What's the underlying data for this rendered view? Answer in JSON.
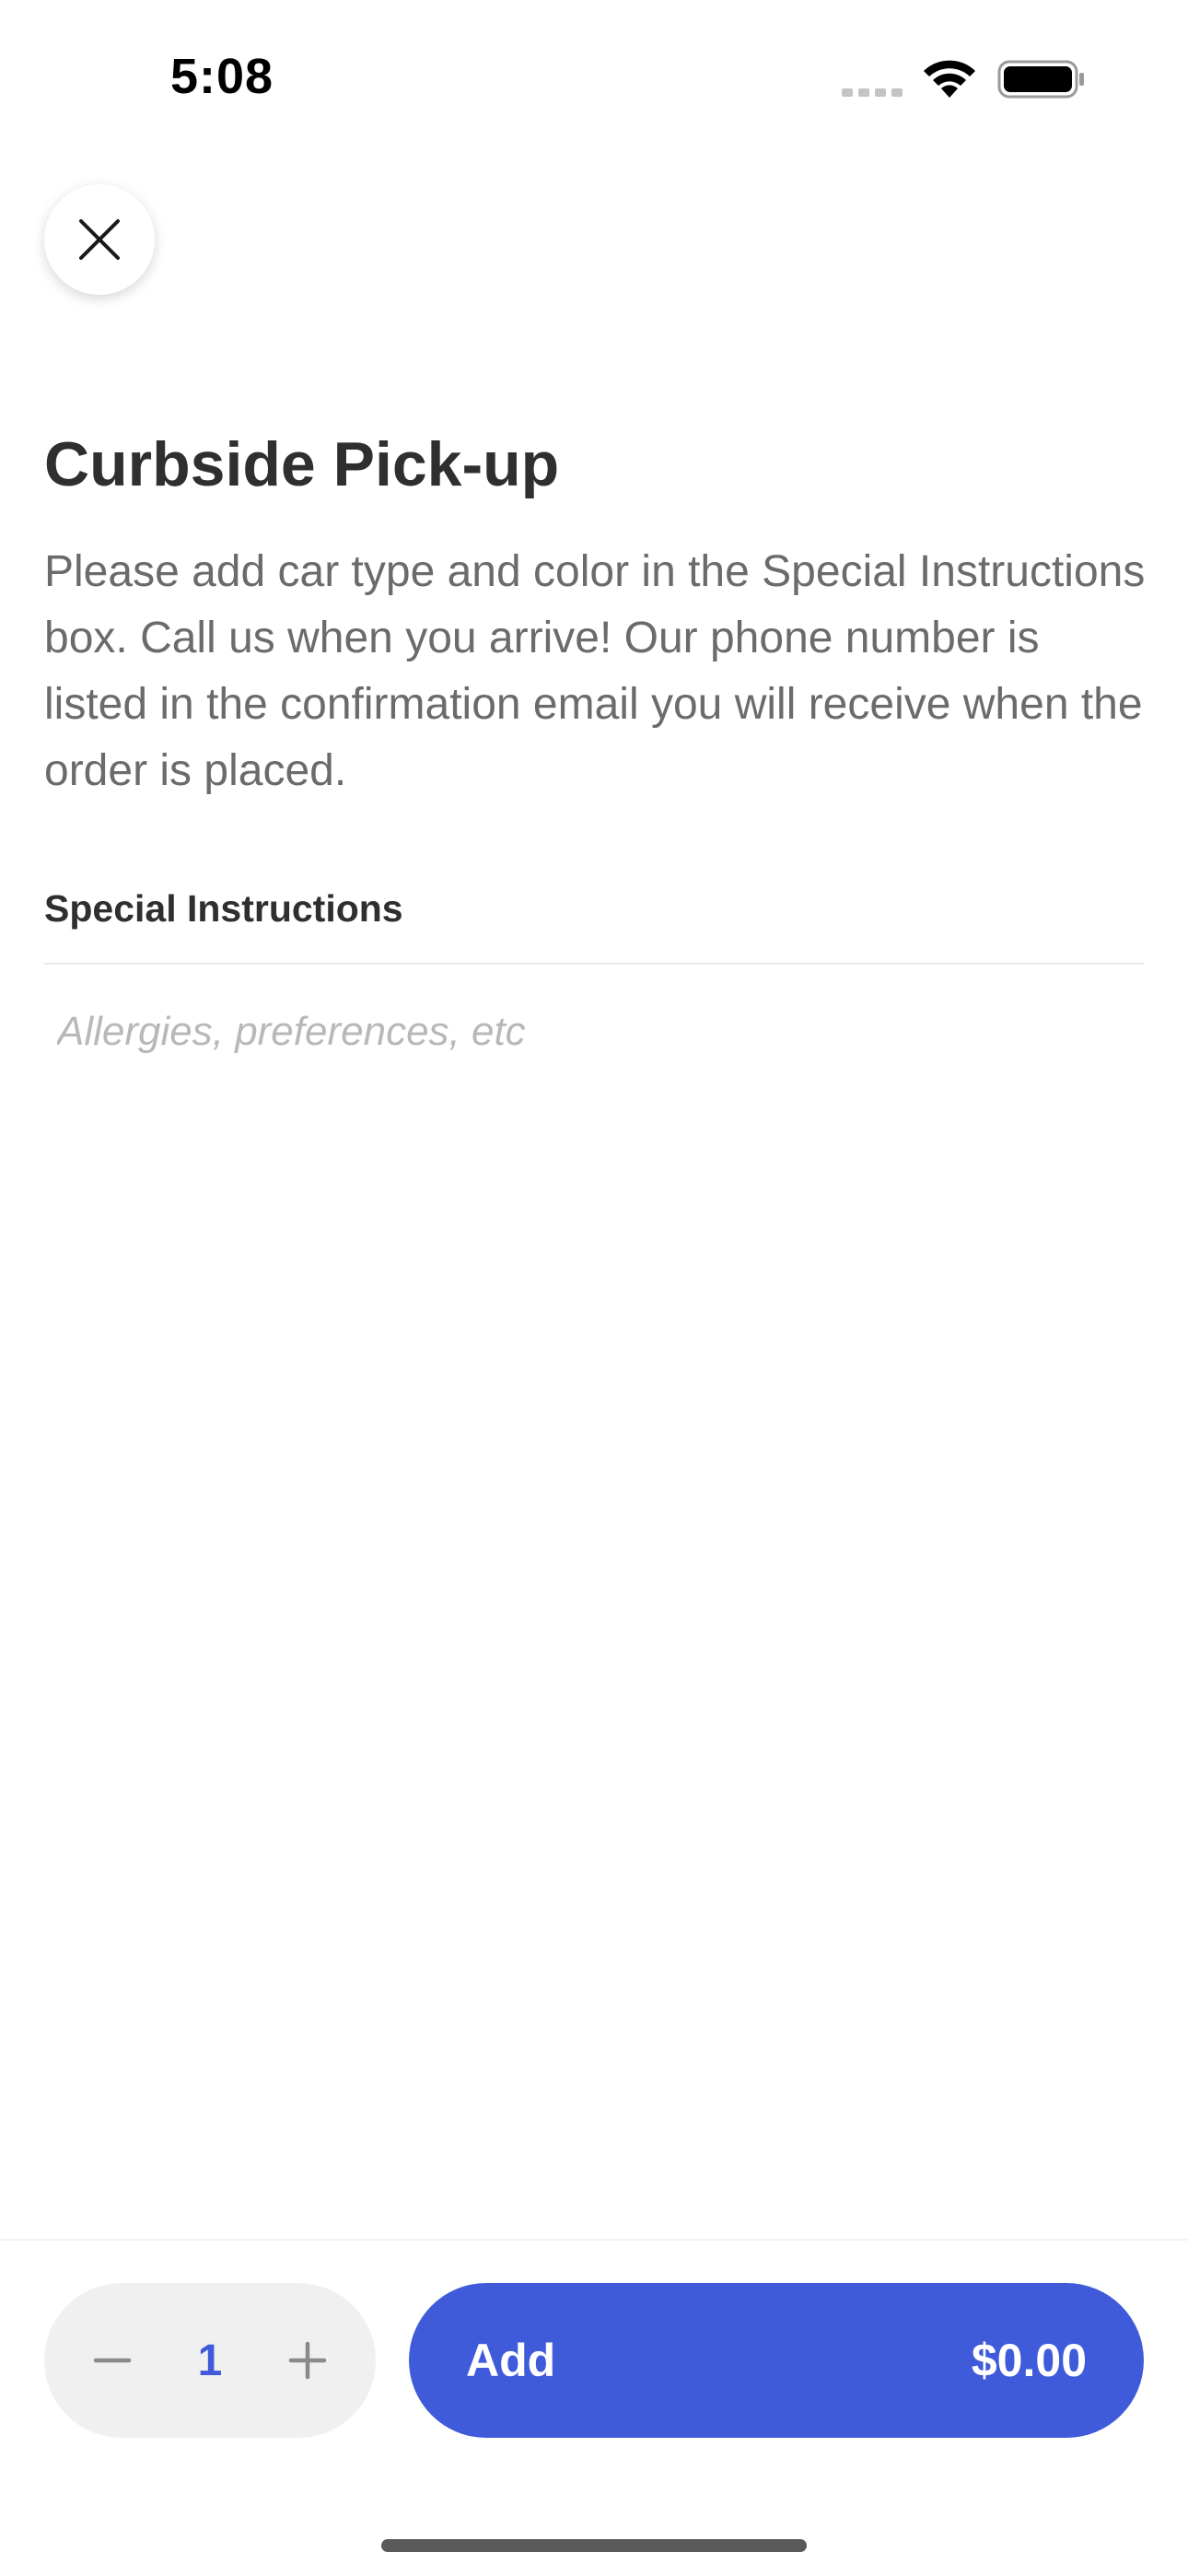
{
  "status_bar": {
    "time": "5:08",
    "signal_icon": "cellular-signal-icon",
    "wifi_icon": "wifi-icon",
    "battery_icon": "battery-icon"
  },
  "close_icon": "close-icon",
  "title": "Curbside Pick-up",
  "description": "Please add car type and color in the Special Instructions box. Call us when you arrive! Our phone number is listed in the confirmation email you will receive when the order is placed.",
  "special_instructions": {
    "label": "Special Instructions",
    "placeholder": "Allergies, preferences, etc",
    "value": ""
  },
  "bottom_bar": {
    "quantity": "1",
    "decrement_icon": "minus-icon",
    "increment_icon": "plus-icon",
    "add_label": "Add",
    "price": "$0.00"
  },
  "colors": {
    "accent": "#3f5bd9",
    "title_text": "#2f2f2f",
    "body_text": "#6b6b6b",
    "placeholder": "#b8b8b8",
    "stepper_bg": "#f0f0f0"
  }
}
